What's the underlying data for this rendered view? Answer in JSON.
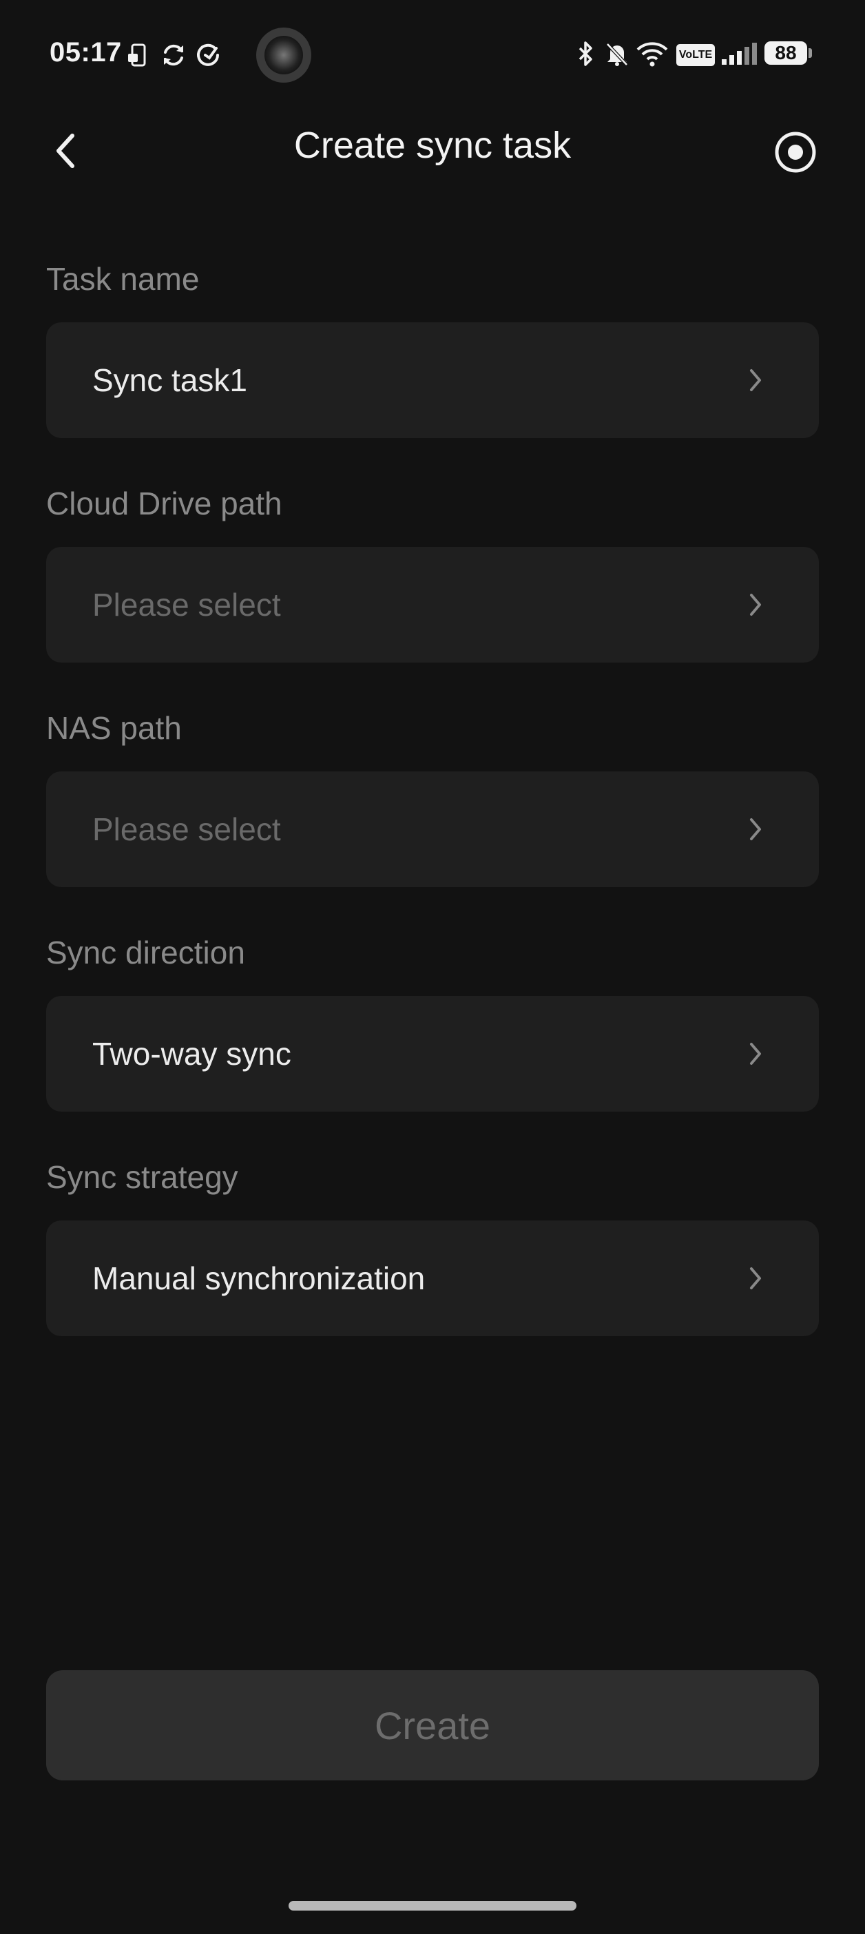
{
  "status_bar": {
    "time": "05:17",
    "battery": "88",
    "volte": "VoLTE",
    "icons": [
      "phone-lock-icon",
      "sync-icon",
      "sync-check-icon",
      "app-avatar",
      "bluetooth-icon",
      "bell-off-icon",
      "wifi-icon",
      "volte-icon",
      "signal-icon",
      "battery-icon"
    ]
  },
  "header": {
    "title": "Create sync task",
    "back_icon": "chevron-left-icon",
    "right_icon": "record-icon"
  },
  "form": {
    "fields": [
      {
        "label": "Task name",
        "value": "Sync task1",
        "placeholder": false
      },
      {
        "label": "Cloud Drive path",
        "value": "Please select",
        "placeholder": true
      },
      {
        "label": "NAS path",
        "value": "Please select",
        "placeholder": true
      },
      {
        "label": "Sync direction",
        "value": "Two-way sync",
        "placeholder": false
      },
      {
        "label": "Sync strategy",
        "value": "Manual synchronization",
        "placeholder": false
      }
    ]
  },
  "actions": {
    "create_label": "Create"
  },
  "colors": {
    "background": "#121212",
    "row_background": "#1f1f1f",
    "label": "#8a8a8a",
    "placeholder": "#6a6a6a",
    "button_disabled_bg": "#2e2e2e",
    "button_disabled_text": "#6d6d6d"
  }
}
